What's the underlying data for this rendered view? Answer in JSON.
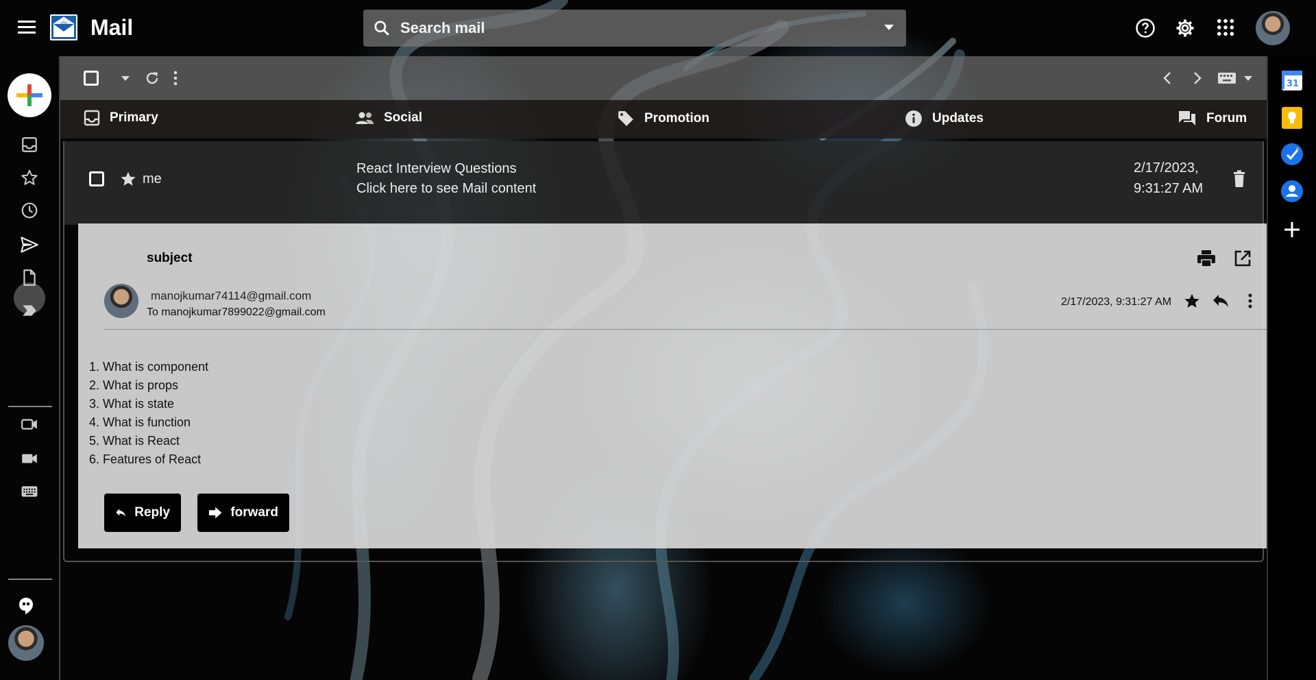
{
  "app": {
    "title": "Mail"
  },
  "search": {
    "placeholder": "Search mail"
  },
  "tabs": [
    {
      "label": "Primary",
      "icon": "inbox-icon"
    },
    {
      "label": "Social",
      "icon": "people-icon"
    },
    {
      "label": "Promotion",
      "icon": "tag-icon"
    },
    {
      "label": "Updates",
      "icon": "info-icon"
    },
    {
      "label": "Forum",
      "icon": "forum-icon"
    }
  ],
  "mail_row": {
    "sender": "me",
    "subject": "React Interview Questions",
    "snippet": "Click here to see Mail content",
    "date_line1": "2/17/2023,",
    "date_line2": "9:31:27 AM"
  },
  "mail_view": {
    "subject": "subject",
    "from": "manojkumar74114@gmail.com",
    "to": "To manojkumar7899022@gmail.com",
    "date": "2/17/2023, 9:31:27 AM",
    "body": [
      "1. What is component",
      "2. What is props",
      "3. What is state",
      "4. What is function",
      "5. What is React",
      "6. Features of React"
    ],
    "reply_label": "Reply",
    "forward_label": "forward"
  },
  "colors": {
    "calendar_blue": "#4285f4",
    "keep_yellow": "#fbbc04",
    "tasks_blue": "#1a73e8",
    "contacts_blue": "#1a73e8"
  },
  "right_panel": {
    "calendar_date": "31"
  }
}
